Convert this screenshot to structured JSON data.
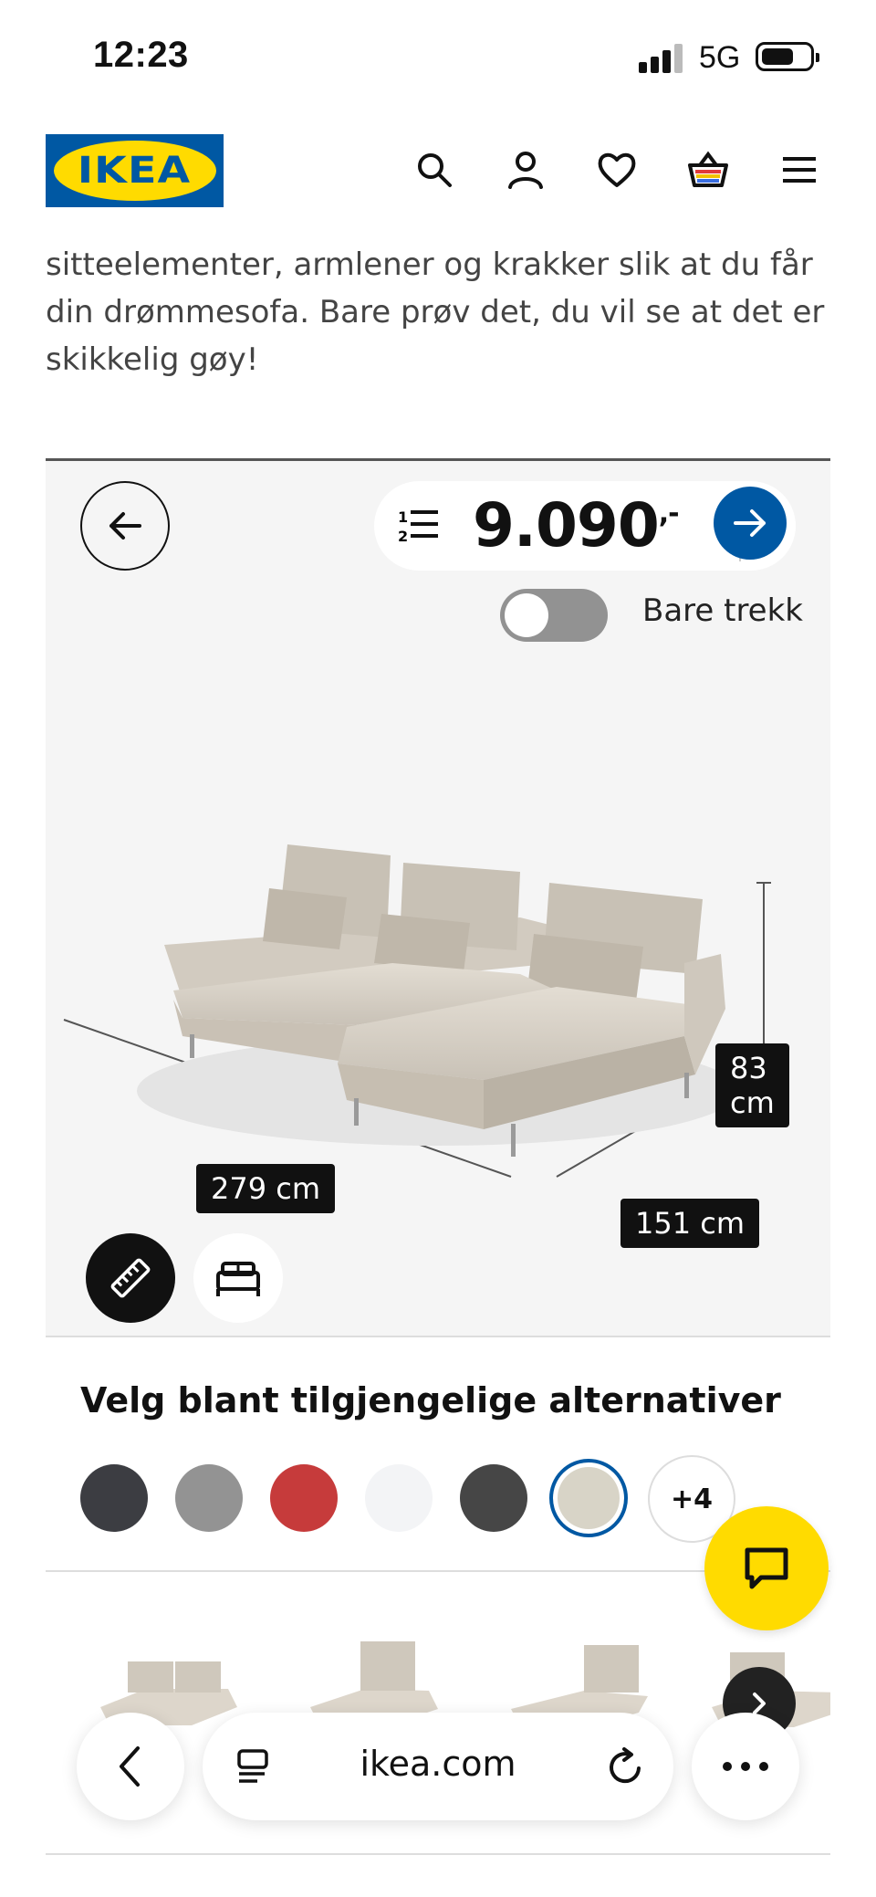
{
  "status_bar": {
    "time": "12:23",
    "network": "5G"
  },
  "header": {
    "logo_text": "IKEA",
    "icons": [
      "search-icon",
      "account-icon",
      "heart-icon",
      "basket-icon",
      "menu-icon"
    ]
  },
  "intro_text": "sitteelementer, armlener og krakker slik at du får din drømmesofa. Bare prøv det, du vil se at det er skikkelig gøy!",
  "configurator": {
    "price": "9.090",
    "price_suffix": ",-",
    "toggle_label": "Bare trekk",
    "toggle_on": false,
    "dimensions": {
      "width": "279 cm",
      "depth": "151 cm",
      "height_value": "83",
      "height_unit": "cm"
    },
    "product_color": "#d6d0c6"
  },
  "alternatives": {
    "title": "Velg blant tilgjengelige alternativer",
    "swatches": [
      "#3c3d42",
      "#939393",
      "#c63b3b",
      "#f3f4f6",
      "#464646",
      "#d8d4c7"
    ],
    "selected_index": 5,
    "more_label": "+4"
  },
  "browser": {
    "url": "ikea.com"
  },
  "colors": {
    "brand_blue": "#0058a3",
    "brand_yellow": "#ffdb00"
  }
}
